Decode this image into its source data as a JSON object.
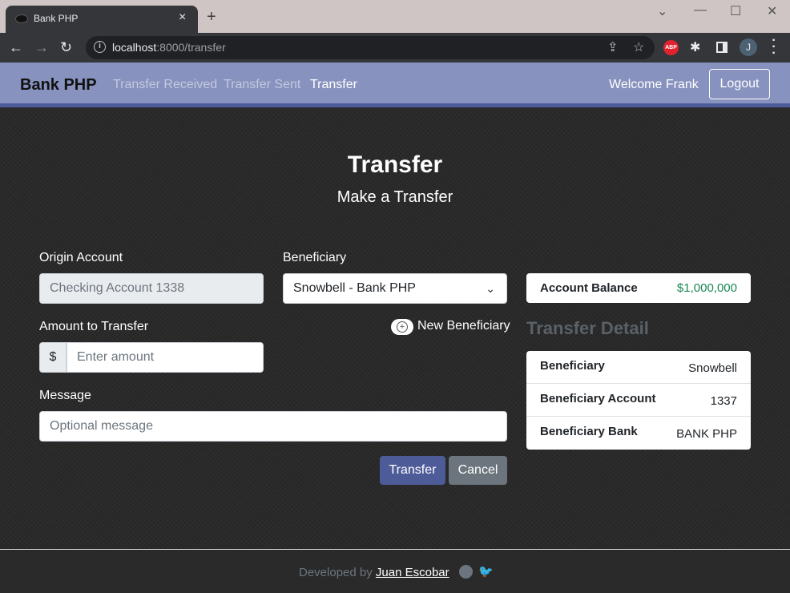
{
  "browser": {
    "tab_title": "Bank PHP",
    "tab_close": "×",
    "new_tab": "+",
    "url_host": "localhost",
    "url_rest": ":8000/transfer",
    "window_controls": {
      "dropdown": "⌄",
      "minimize": "—",
      "maximize": "☐",
      "close": "✕"
    },
    "nav": {
      "back": "←",
      "forward": "→",
      "reload": "↻"
    },
    "info_icon": "i",
    "share_icon": "⇪",
    "star_icon": "☆",
    "ext_abp": "ABP",
    "ext_puzzle": "✱",
    "avatar_initial": "J",
    "menu_icon": "⋮"
  },
  "navbar": {
    "brand": "Bank PHP",
    "links": [
      "Transfer Received",
      "Transfer Sent",
      "Transfer"
    ],
    "active_link": "Transfer",
    "welcome": "Welcome Frank",
    "logout_label": "Logout"
  },
  "page": {
    "title": "Transfer",
    "subtitle": "Make a Transfer"
  },
  "form": {
    "origin_label": "Origin Account",
    "origin_value": "Checking Account 1338",
    "beneficiary_label": "Beneficiary",
    "beneficiary_selected": "Snowbell - Bank PHP",
    "amount_label": "Amount to Transfer",
    "currency_symbol": "$",
    "amount_placeholder": "Enter amount",
    "new_beneficiary_label": "New Beneficiary",
    "message_label": "Message",
    "message_placeholder": "Optional message",
    "submit_label": "Transfer",
    "cancel_label": "Cancel"
  },
  "sidebar": {
    "balance_label": "Account Balance",
    "balance_value": "$1,000,000",
    "balance_color": "#198754",
    "detail_title": "Transfer Detail",
    "details": [
      {
        "key": "Beneficiary",
        "value": "Snowbell"
      },
      {
        "key": "Beneficiary Account",
        "value": "1337"
      },
      {
        "key": "Beneficiary Bank",
        "value": "BANK PHP"
      }
    ]
  },
  "footer": {
    "prefix": "Developed by ",
    "author": "Juan Escobar"
  },
  "colors": {
    "navbar": "#8792be",
    "primary": "#4e5b99",
    "secondary": "#6c757d"
  }
}
